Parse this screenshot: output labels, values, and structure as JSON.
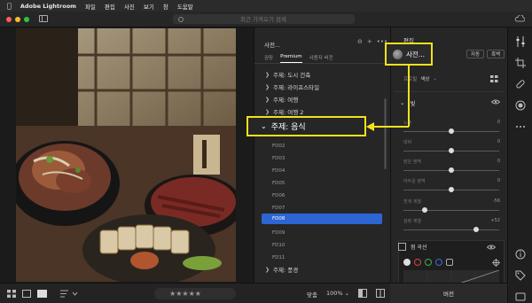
{
  "menubar": {
    "app_name": "Adobe Lightroom",
    "items": [
      "파일",
      "편집",
      "사진",
      "보기",
      "창",
      "도움말"
    ]
  },
  "search": {
    "placeholder": "최근 가져오기 검색"
  },
  "bottom_bar": {
    "fit_label": "맞춤",
    "zoom_value": "100%",
    "zoom_chevron": "⌄",
    "stars": "★★★★★"
  },
  "presets": {
    "title": "사전...",
    "tools": {
      "collapse": "⊖",
      "add": "+",
      "more": "•••",
      "close": "×"
    },
    "tabs": [
      {
        "label": "권장",
        "active": false
      },
      {
        "label": "Premium",
        "active": true
      },
      {
        "label": "사용자 버전",
        "active": false
      }
    ],
    "groups": [
      {
        "label": "주제: 도시 건축"
      },
      {
        "label": "주제: 라이프스타일"
      },
      {
        "label": "주제: 여행"
      },
      {
        "label": "주제: 여행 2"
      }
    ],
    "open_group": "주제: 음식",
    "items": [
      "FD02",
      "FD03",
      "FD04",
      "FD05",
      "FD06",
      "FD07"
    ],
    "selected": "FD08",
    "items_after": [
      "FD09",
      "FD10",
      "FD11"
    ],
    "last_group": "주제: 풍경"
  },
  "edit": {
    "title": "편집",
    "presets_button": "사전...",
    "auto_label": "자동",
    "bw_label": "흑백",
    "profile_label": "프로필",
    "profile_value": "색상",
    "light_header": "빛",
    "sliders": [
      {
        "label": "노출",
        "value": "0",
        "pos": 0.5
      },
      {
        "label": "대비",
        "value": "0",
        "pos": 0.5
      },
      {
        "label": "밝은 영역",
        "value": "0",
        "pos": 0.5
      },
      {
        "label": "어두운 영역",
        "value": "0",
        "pos": 0.5
      },
      {
        "label": "흰색 계열",
        "value": "-56",
        "pos": 0.22
      },
      {
        "label": "검정 계열",
        "value": "+52",
        "pos": 0.76
      }
    ],
    "curve_header": "점 곡선",
    "version_button": "버전"
  },
  "colors": {
    "accent_blue": "#2d66d4",
    "highlight_yellow": "#f3e21a",
    "panel_bg": "#262626"
  }
}
